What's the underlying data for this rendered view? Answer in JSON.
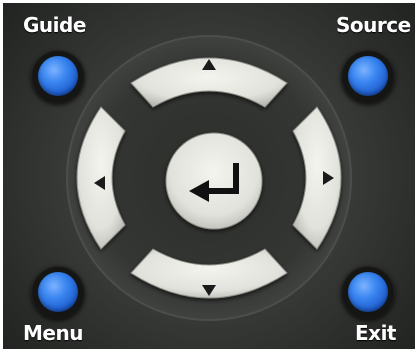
{
  "buttons": {
    "guide": "Guide",
    "source": "Source",
    "menu": "Menu",
    "exit": "Exit"
  },
  "dpad": {
    "up_icon": "triangle-up-icon",
    "down_icon": "triangle-down-icon",
    "left_icon": "triangle-left-icon",
    "right_icon": "triangle-right-icon",
    "center_icon": "enter-return-icon"
  },
  "colors": {
    "body": "#3a3c39",
    "button_light": "#e8e8e2",
    "accent_blue": "#2f7fe8"
  }
}
